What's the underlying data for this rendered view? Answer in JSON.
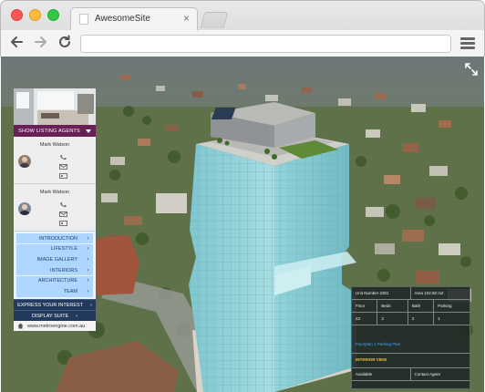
{
  "browser": {
    "tab_title": "AwesomeSite",
    "tab_close": "×",
    "url": ""
  },
  "panel": {
    "show_agents_label": "SHOW LISTING AGENTS",
    "agents": [
      {
        "name": "Mark Watson"
      },
      {
        "name": "Mark Watson"
      }
    ],
    "menu_items": [
      {
        "label": "INTRODUCTION"
      },
      {
        "label": "LIFESTYLE"
      },
      {
        "label": "IMAGE GALLERY"
      },
      {
        "label": "INTERIORS"
      },
      {
        "label": "ARCHITECTURE"
      },
      {
        "label": "TEAM"
      }
    ],
    "express_label": "EXPRESS YOUR INTEREST",
    "display_suite_label": "DISPLAY SUITE",
    "website": "www.metroengine.com.au"
  },
  "info": {
    "unit_label": "Unit Number 2301",
    "area_label": "Area 102.50 m2",
    "headers": [
      "Floor",
      "Beds",
      "Bath",
      "Parking"
    ],
    "values": [
      "23",
      "2",
      "2",
      "1"
    ],
    "floorplan_link": "Floorplan 1 Parking Plan",
    "interior_view": "INTERIOR VIEW",
    "status": "Available",
    "contact_agent": "Contact Agent"
  },
  "colors": {
    "agents_button": "#6a1f57",
    "menu_item_bg": "#add7ff",
    "suite_button": "#233a5c",
    "floorplan_link": "#4ba3ff",
    "interior_view": "#f0c13c"
  },
  "icons": [
    "back-arrow-icon",
    "forward-arrow-icon",
    "reload-icon",
    "hamburger-menu-icon",
    "fullscreen-icon",
    "chevron-down-icon",
    "chevron-right-icon",
    "phone-icon",
    "email-icon",
    "house-icon"
  ]
}
